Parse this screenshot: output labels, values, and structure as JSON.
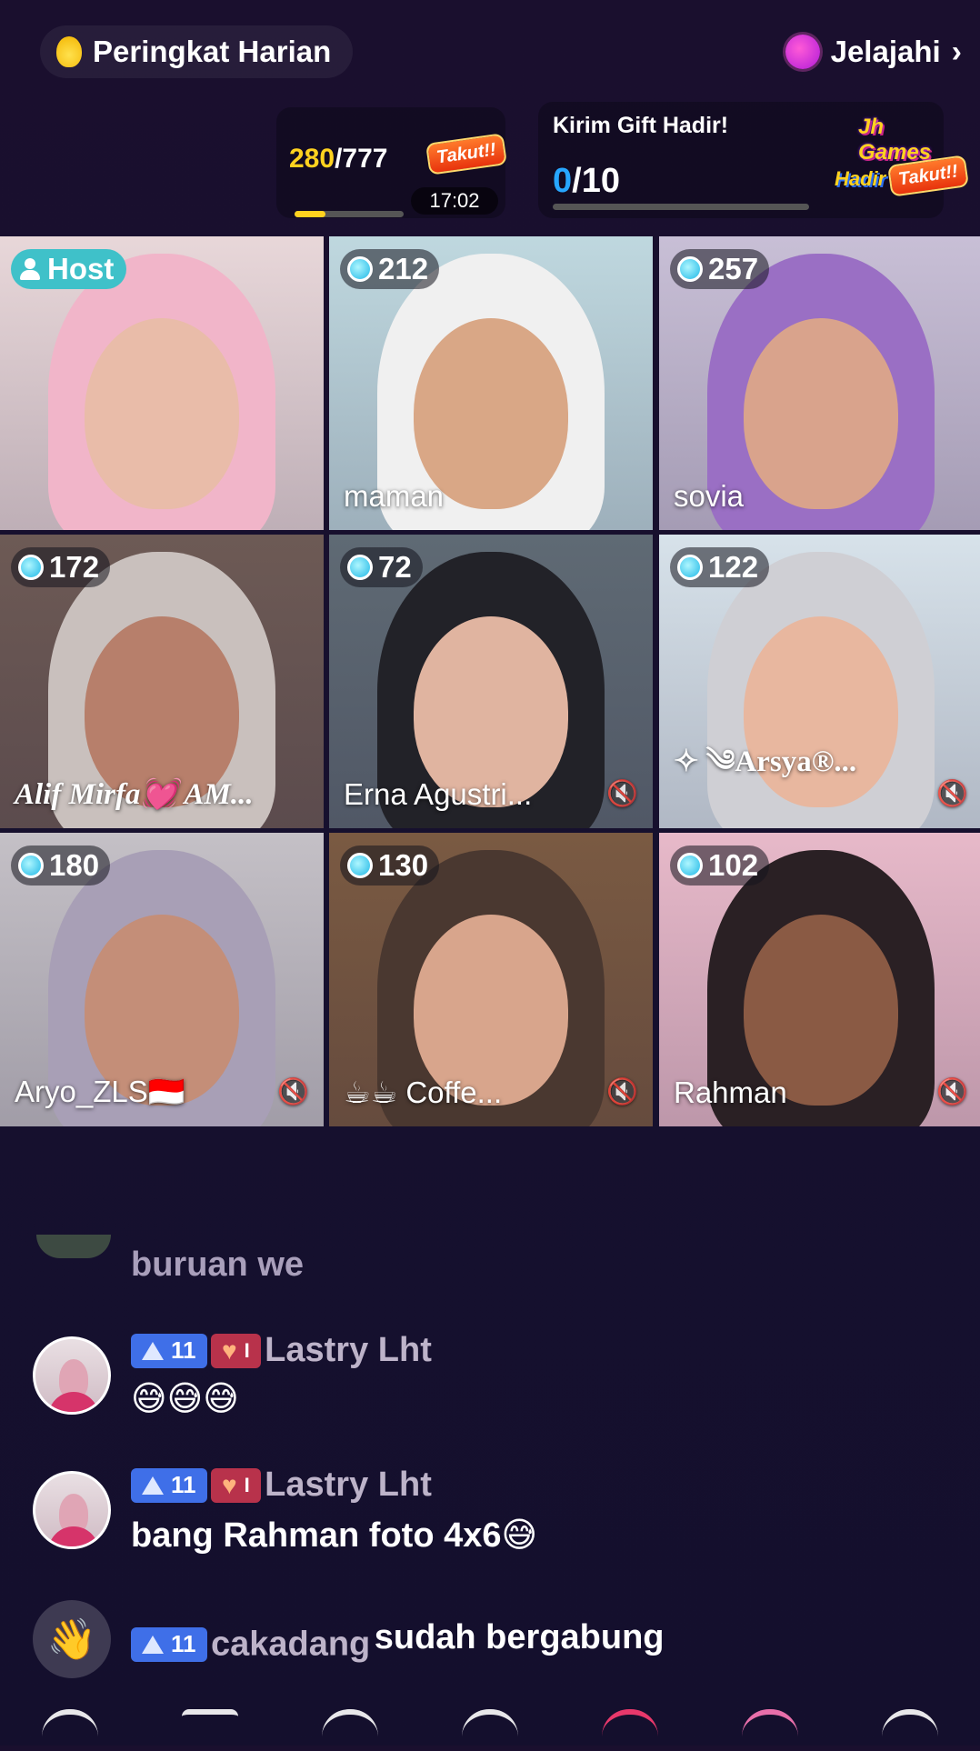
{
  "header": {
    "ranking_label": "Peringkat Harian",
    "explore_label": "Jelajahi",
    "explore_chevron": "›"
  },
  "progress": {
    "current": "280",
    "total": "/777",
    "fill_fraction": 0.28,
    "badge": "Takut!!",
    "timer": "17:02"
  },
  "gift_task": {
    "title": "Kirim Gift Hadir!",
    "current": "0",
    "total": "/10",
    "badge_top": "Jh Games",
    "badge_hadir": "Hadir",
    "badge_takut": "Takut!!"
  },
  "seats": [
    {
      "host": true,
      "host_label": "Host",
      "name": "",
      "score": "",
      "muted": false,
      "bg": "#e8d7d9",
      "cover": "#f1b5c9",
      "face": "#e9bca9"
    },
    {
      "host": false,
      "score": "212",
      "name": "maman",
      "muted": false,
      "bg": "#bfd8df",
      "cover": "#f0f0f0",
      "face": "#d9a786"
    },
    {
      "host": false,
      "score": "257",
      "name": "sovia",
      "muted": false,
      "bg": "#c8bfd6",
      "cover": "#9a6fc4",
      "face": "#d9a38c"
    },
    {
      "host": false,
      "score": "172",
      "name": "Alif Mirfa💓 AM...",
      "muted": false,
      "bg": "#6d5a55",
      "cover": "#c9c0bd",
      "face": "#b77f6b"
    },
    {
      "host": false,
      "score": "72",
      "name": "Erna Agustri...",
      "muted": true,
      "bg": "#5f6a74",
      "cover": "#222228",
      "face": "#e0b4a0"
    },
    {
      "host": false,
      "score": "122",
      "name": "✧ ༄Arsya®...",
      "muted": true,
      "bg": "#d7e2ea",
      "cover": "#cfcfd4",
      "face": "#e8b79f"
    },
    {
      "host": false,
      "score": "180",
      "name": "Aryo_ZLS🇮🇩",
      "muted": true,
      "bg": "#c4c0c6",
      "cover": "#a89fb6",
      "face": "#c48e78"
    },
    {
      "host": false,
      "score": "130",
      "name": "☕☕ Coffe...",
      "muted": true,
      "bg": "#7a5a42",
      "cover": "#4a3830",
      "face": "#d8a58c"
    },
    {
      "host": false,
      "score": "102",
      "name": "Rahman",
      "muted": true,
      "bg": "#e7b9c9",
      "cover": "#2a2024",
      "face": "#8a5a44"
    }
  ],
  "mute_icon": "🔇",
  "chat": {
    "partial_message": "buruan we",
    "messages": [
      {
        "level": "11",
        "fan_level": "I",
        "user": "Lastry Lht",
        "text": "😅😅😅"
      },
      {
        "level": "11",
        "fan_level": "I",
        "user": "Lastry Lht",
        "text": "bang Rahman foto 4x6😅"
      }
    ],
    "join": {
      "level": "11",
      "user": "cakadang",
      "text": "sudah bergabung",
      "icon": "👋"
    }
  }
}
